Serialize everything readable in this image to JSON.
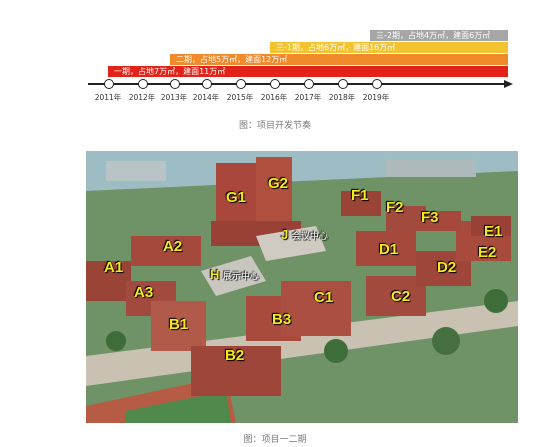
{
  "timeline": {
    "phases": [
      {
        "label": "三-2期，占地4万㎡，建面6万㎡"
      },
      {
        "label": "三-1期，占地6万㎡，建面16万㎡"
      },
      {
        "label": "二期，占地5万㎡，建面12万㎡"
      },
      {
        "label": "一期，占地7万㎡，建面11万㎡"
      }
    ],
    "years": [
      "2011年",
      "2012年",
      "2013年",
      "2014年",
      "2015年",
      "2016年",
      "2017年",
      "2018年",
      "2019年"
    ],
    "colors": {
      "phase1": "#e2231a",
      "phase2": "#f08a2a",
      "phase3_1": "#f4c430",
      "phase3_2": "#a6a6a6"
    }
  },
  "captions": {
    "timeline": "图：项目开发节奏",
    "render": "图：项目一二期"
  },
  "render": {
    "labels": [
      "G1",
      "G2",
      "F1",
      "F2",
      "F3",
      "E1",
      "E2",
      "A2",
      "A1",
      "A3",
      "J",
      "D1",
      "D2",
      "H",
      "C1",
      "C2",
      "B1",
      "B3",
      "B2"
    ],
    "center_j": "会议中心",
    "center_h": "展示中心"
  }
}
